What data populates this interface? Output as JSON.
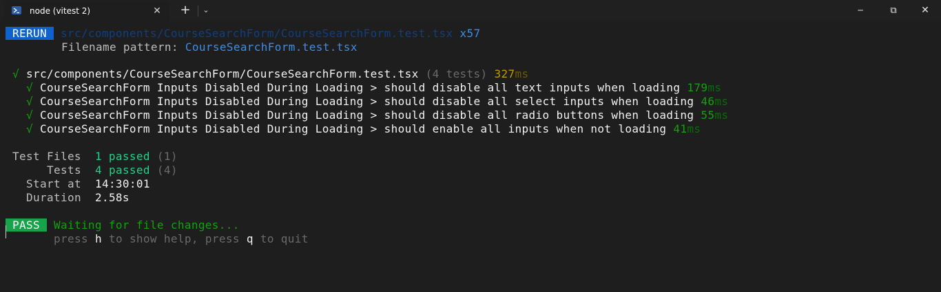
{
  "window": {
    "tab_title": "node (vitest 2)",
    "tab_icon": "powershell-icon",
    "close_symbol": "✕",
    "new_tab_symbol": "+",
    "dropdown_symbol": "⌄",
    "minimize_symbol": "─",
    "maximize_symbol": "⧉",
    "window_close_symbol": "✕"
  },
  "terminal": {
    "rerun": {
      "badge": " RERUN ",
      "path": "src/components/CourseSearchForm/CourseSearchForm.test.tsx",
      "count": "x57",
      "pattern_label": "Filename pattern: ",
      "pattern_value": "CourseSearchForm.test.tsx"
    },
    "suite": {
      "check": "√",
      "file": "src/components/CourseSearchForm/CourseSearchForm.test.tsx",
      "tests": "(4 tests)",
      "time": "327",
      "unit": "ms"
    },
    "tests": [
      {
        "check": "√",
        "name": "CourseSearchForm Inputs Disabled During Loading > should disable all text inputs when loading",
        "time": "179",
        "unit": "ms"
      },
      {
        "check": "√",
        "name": "CourseSearchForm Inputs Disabled During Loading > should disable all select inputs when loading",
        "time": "46",
        "unit": "ms"
      },
      {
        "check": "√",
        "name": "CourseSearchForm Inputs Disabled During Loading > should disable all radio buttons when loading",
        "time": "55",
        "unit": "ms"
      },
      {
        "check": "√",
        "name": "CourseSearchForm Inputs Disabled During Loading > should enable all inputs when not loading",
        "time": "41",
        "unit": "ms"
      }
    ],
    "summary": {
      "files_label": "Test Files",
      "files_passed": "1 passed",
      "files_total": "(1)",
      "tests_label": "Tests",
      "tests_passed": "4 passed",
      "tests_total": "(4)",
      "start_label": "Start at",
      "start_value": "14:30:01",
      "duration_label": "Duration",
      "duration_value": "2.58s"
    },
    "status": {
      "badge": " PASS ",
      "message": "Waiting for file changes...",
      "help_prefix": "press ",
      "help_key_h": "h",
      "help_mid": " to show help, press ",
      "help_key_q": "q",
      "help_suffix": " to quit"
    }
  },
  "colors": {
    "background": "#1e1e1e",
    "titlebar": "#202020",
    "rerun_badge": "#0f62c9",
    "pass_badge": "#16a34a",
    "green": "#23d18b",
    "blue": "#3b8eea",
    "yellow": "#c19c00"
  }
}
